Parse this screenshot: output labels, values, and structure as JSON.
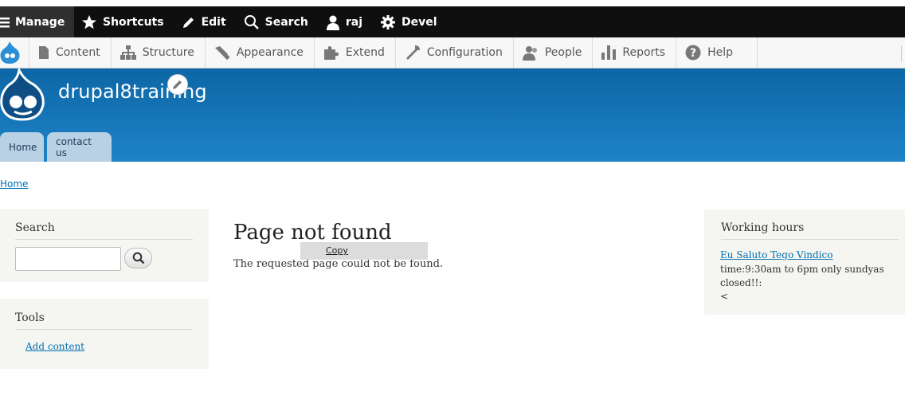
{
  "toolbar": {
    "items": [
      {
        "label": "Manage",
        "icon": "hamburger-icon"
      },
      {
        "label": "Shortcuts",
        "icon": "star-icon"
      },
      {
        "label": "Edit",
        "icon": "pencil-icon"
      },
      {
        "label": "Search",
        "icon": "search-icon"
      },
      {
        "label": "raj",
        "icon": "user-icon"
      },
      {
        "label": "Devel",
        "icon": "gear-icon"
      }
    ]
  },
  "tray": {
    "items": [
      {
        "label": "Content",
        "icon": "file-icon"
      },
      {
        "label": "Structure",
        "icon": "sitemap-icon"
      },
      {
        "label": "Appearance",
        "icon": "paintbrush-icon"
      },
      {
        "label": "Extend",
        "icon": "puzzle-icon"
      },
      {
        "label": "Configuration",
        "icon": "wrench-icon"
      },
      {
        "label": "People",
        "icon": "people-icon"
      },
      {
        "label": "Reports",
        "icon": "bar-chart-icon"
      },
      {
        "label": "Help",
        "icon": "help-icon"
      }
    ]
  },
  "header": {
    "site_name": "drupal8training",
    "nav": [
      "Home",
      "contact us"
    ]
  },
  "breadcrumb": "Home",
  "sidebar": {
    "search_title": "Search",
    "tools_title": "Tools",
    "tools_link": "Add content"
  },
  "main": {
    "title": "Page not found",
    "message": "The requested page could not be found.",
    "context_menu": "Copy"
  },
  "working_hours": {
    "title": "Working hours",
    "link": "Eu Saluto Tego Vindico",
    "line1": "time:9:30am to 6pm only sundyas",
    "line2": "closed!!:",
    "line3": "<"
  },
  "colors": {
    "toolbar_bg": "#0f0f0f",
    "header_top": "#0d66a6",
    "header_bottom": "#1d84c7",
    "link": "#0071b3",
    "sidebar_bg": "#f5f5f1"
  }
}
